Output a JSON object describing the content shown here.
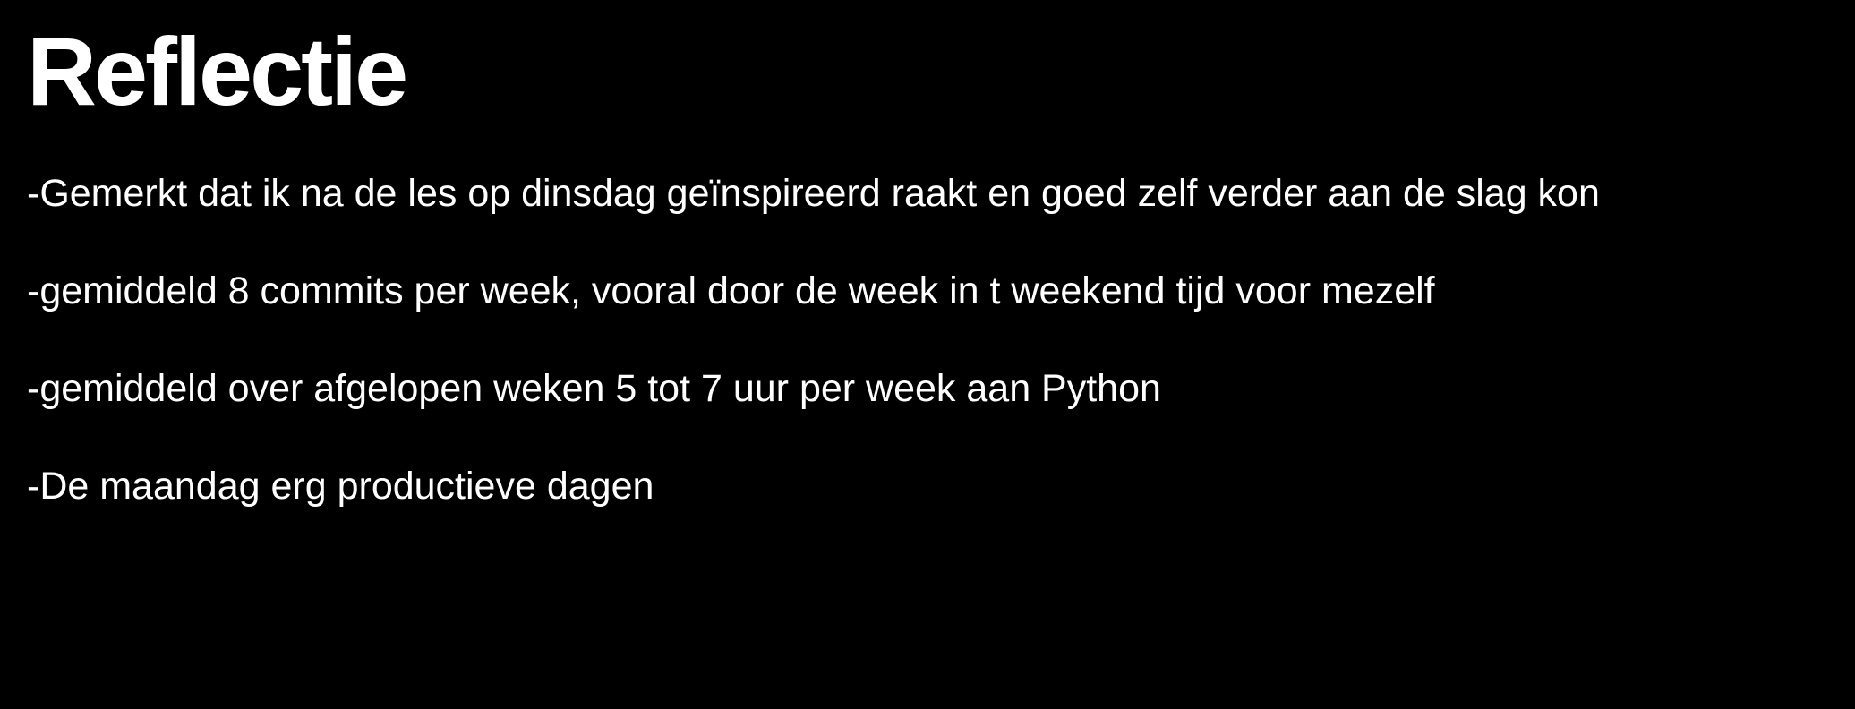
{
  "slide": {
    "title": "Reflectie",
    "bullets": [
      "-Gemerkt dat ik na de les op dinsdag geïnspireerd raakt en goed zelf verder aan de slag kon",
      "-gemiddeld 8 commits per week, vooral door de week in t weekend tijd voor mezelf",
      "-gemiddeld over afgelopen weken 5 tot 7 uur per week aan Python",
      "-De maandag erg productieve dagen"
    ]
  },
  "colors": {
    "background": "#000000",
    "text": "#ffffff"
  }
}
